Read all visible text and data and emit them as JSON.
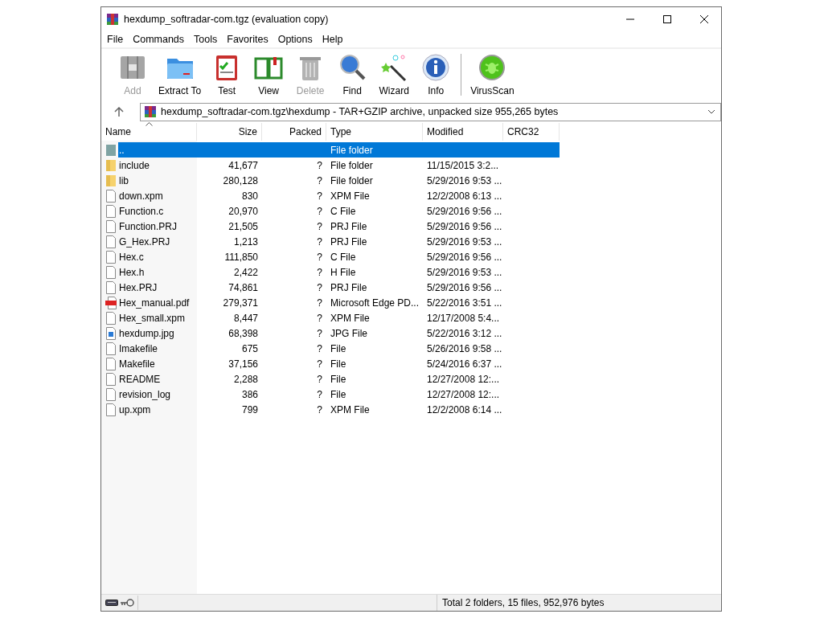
{
  "window": {
    "title": "hexdump_softradar-com.tgz (evaluation copy)"
  },
  "menu": [
    "File",
    "Commands",
    "Tools",
    "Favorites",
    "Options",
    "Help"
  ],
  "toolbar": [
    {
      "label": "Add",
      "kind": "add",
      "disabled": true
    },
    {
      "label": "Extract To",
      "kind": "extract",
      "disabled": false
    },
    {
      "label": "Test",
      "kind": "test",
      "disabled": false
    },
    {
      "label": "View",
      "kind": "view",
      "disabled": false
    },
    {
      "label": "Delete",
      "kind": "delete",
      "disabled": true
    },
    {
      "label": "Find",
      "kind": "find",
      "disabled": false
    },
    {
      "label": "Wizard",
      "kind": "wizard",
      "disabled": false
    },
    {
      "label": "Info",
      "kind": "info",
      "disabled": false
    },
    {
      "label": "VirusScan",
      "kind": "virus",
      "disabled": false
    }
  ],
  "address": {
    "value": "hexdump_softradar-com.tgz\\hexdump - TAR+GZIP archive, unpacked size 955,265 bytes"
  },
  "table": {
    "columns": [
      "Name",
      "Size",
      "Packed",
      "Type",
      "Modified",
      "CRC32"
    ],
    "rows": [
      {
        "kind": "parent",
        "name": "..",
        "size": "",
        "packed": "",
        "type": "File folder",
        "modified": "",
        "selected": true
      },
      {
        "kind": "folder",
        "name": "include",
        "size": "41,677",
        "packed": "?",
        "type": "File folder",
        "modified": "11/15/2015 3:2...",
        "selected": false
      },
      {
        "kind": "folder",
        "name": "lib",
        "size": "280,128",
        "packed": "?",
        "type": "File folder",
        "modified": "5/29/2016 9:53 ...",
        "selected": false
      },
      {
        "kind": "file",
        "name": "down.xpm",
        "size": "830",
        "packed": "?",
        "type": "XPM File",
        "modified": "12/2/2008 6:13 ...",
        "selected": false
      },
      {
        "kind": "file",
        "name": "Function.c",
        "size": "20,970",
        "packed": "?",
        "type": "C File",
        "modified": "5/29/2016 9:56 ...",
        "selected": false
      },
      {
        "kind": "file",
        "name": "Function.PRJ",
        "size": "21,505",
        "packed": "?",
        "type": "PRJ File",
        "modified": "5/29/2016 9:56 ...",
        "selected": false
      },
      {
        "kind": "file",
        "name": "G_Hex.PRJ",
        "size": "1,213",
        "packed": "?",
        "type": "PRJ File",
        "modified": "5/29/2016 9:53 ...",
        "selected": false
      },
      {
        "kind": "file",
        "name": "Hex.c",
        "size": "111,850",
        "packed": "?",
        "type": "C File",
        "modified": "5/29/2016 9:56 ...",
        "selected": false
      },
      {
        "kind": "file",
        "name": "Hex.h",
        "size": "2,422",
        "packed": "?",
        "type": "H File",
        "modified": "5/29/2016 9:53 ...",
        "selected": false
      },
      {
        "kind": "file",
        "name": "Hex.PRJ",
        "size": "74,861",
        "packed": "?",
        "type": "PRJ File",
        "modified": "5/29/2016 9:56 ...",
        "selected": false
      },
      {
        "kind": "pdf",
        "name": "Hex_manual.pdf",
        "size": "279,371",
        "packed": "?",
        "type": "Microsoft Edge PD...",
        "modified": "5/22/2016 3:51 ...",
        "selected": false
      },
      {
        "kind": "file",
        "name": "Hex_small.xpm",
        "size": "8,447",
        "packed": "?",
        "type": "XPM File",
        "modified": "12/17/2008 5:4...",
        "selected": false
      },
      {
        "kind": "image",
        "name": "hexdump.jpg",
        "size": "68,398",
        "packed": "?",
        "type": "JPG File",
        "modified": "5/22/2016 3:12 ...",
        "selected": false
      },
      {
        "kind": "file",
        "name": "Imakefile",
        "size": "675",
        "packed": "?",
        "type": "File",
        "modified": "5/26/2016 9:58 ...",
        "selected": false
      },
      {
        "kind": "file",
        "name": "Makefile",
        "size": "37,156",
        "packed": "?",
        "type": "File",
        "modified": "5/24/2016 6:37 ...",
        "selected": false
      },
      {
        "kind": "file",
        "name": "README",
        "size": "2,288",
        "packed": "?",
        "type": "File",
        "modified": "12/27/2008 12:...",
        "selected": false
      },
      {
        "kind": "file",
        "name": "revision_log",
        "size": "386",
        "packed": "?",
        "type": "File",
        "modified": "12/27/2008 12:...",
        "selected": false
      },
      {
        "kind": "file",
        "name": "up.xpm",
        "size": "799",
        "packed": "?",
        "type": "XPM File",
        "modified": "12/2/2008 6:14 ...",
        "selected": false
      }
    ]
  },
  "status_bar": {
    "text": "Total 2 folders, 15 files, 952,976 bytes"
  }
}
